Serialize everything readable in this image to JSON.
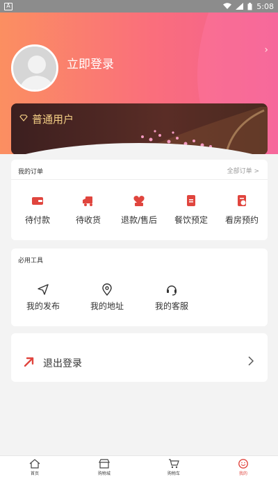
{
  "status_bar": {
    "time": "5:08"
  },
  "profile": {
    "login_label": "立即登录"
  },
  "member": {
    "level_label": "普通用户"
  },
  "orders": {
    "title": "我的订单",
    "all_label": "全部订单 >",
    "items": [
      {
        "label": "待付款",
        "icon": "wallet-icon"
      },
      {
        "label": "待收货",
        "icon": "delivery-truck-icon"
      },
      {
        "label": "退款/售后",
        "icon": "refund-icon"
      },
      {
        "label": "餐饮预定",
        "icon": "catering-icon"
      },
      {
        "label": "看房预约",
        "icon": "house-booking-icon"
      }
    ]
  },
  "tools": {
    "title": "必用工具",
    "items": [
      {
        "label": "我的发布",
        "icon": "send-icon"
      },
      {
        "label": "我的地址",
        "icon": "location-pin-icon"
      },
      {
        "label": "我的客服",
        "icon": "headset-icon"
      }
    ]
  },
  "logout": {
    "label": "退出登录"
  },
  "tabbar": {
    "items": [
      {
        "label": "首页",
        "icon": "home-icon"
      },
      {
        "label": "购物城",
        "icon": "store-icon"
      },
      {
        "label": "购物车",
        "icon": "cart-icon"
      },
      {
        "label": "我的",
        "icon": "profile-icon",
        "active": true
      }
    ]
  },
  "colors": {
    "accent": "#e0453e",
    "gold": "#f4cf85",
    "hero_start": "#fb8f61",
    "hero_end": "#f25f95"
  }
}
